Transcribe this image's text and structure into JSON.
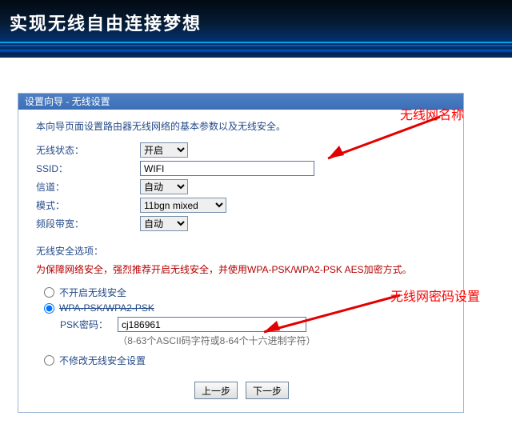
{
  "banner": {
    "title": "实现无线自由连接梦想"
  },
  "panel": {
    "title": "设置向导 - 无线设置",
    "intro": "本向导页面设置路由器无线网络的基本参数以及无线安全。",
    "rows": {
      "wireless_state": {
        "label": "无线状态：",
        "value": "开启"
      },
      "ssid": {
        "label": "SSID：",
        "value": "WIFI"
      },
      "channel": {
        "label": "信道：",
        "value": "自动"
      },
      "mode": {
        "label": "模式：",
        "value": "11bgn mixed"
      },
      "bandwidth": {
        "label": "频段带宽：",
        "value": "自动"
      }
    },
    "security": {
      "heading": "无线安全选项：",
      "note": "为保障网络安全，强烈推荐开启无线安全，并使用WPA-PSK/WPA2-PSK AES加密方式。",
      "opt_off": "不开启无线安全",
      "opt_wpa": "WPA-PSK/WPA2-PSK",
      "psk_label": "PSK密码：",
      "psk_value": "cj186961",
      "psk_hint": "（8-63个ASCII码字符或8-64个十六进制字符）",
      "opt_keep": "不修改无线安全设置"
    },
    "buttons": {
      "prev": "上一步",
      "next": "下一步"
    }
  },
  "annotations": {
    "ssid_label": "无线网名称",
    "pwd_label": "无线网密码设置"
  }
}
